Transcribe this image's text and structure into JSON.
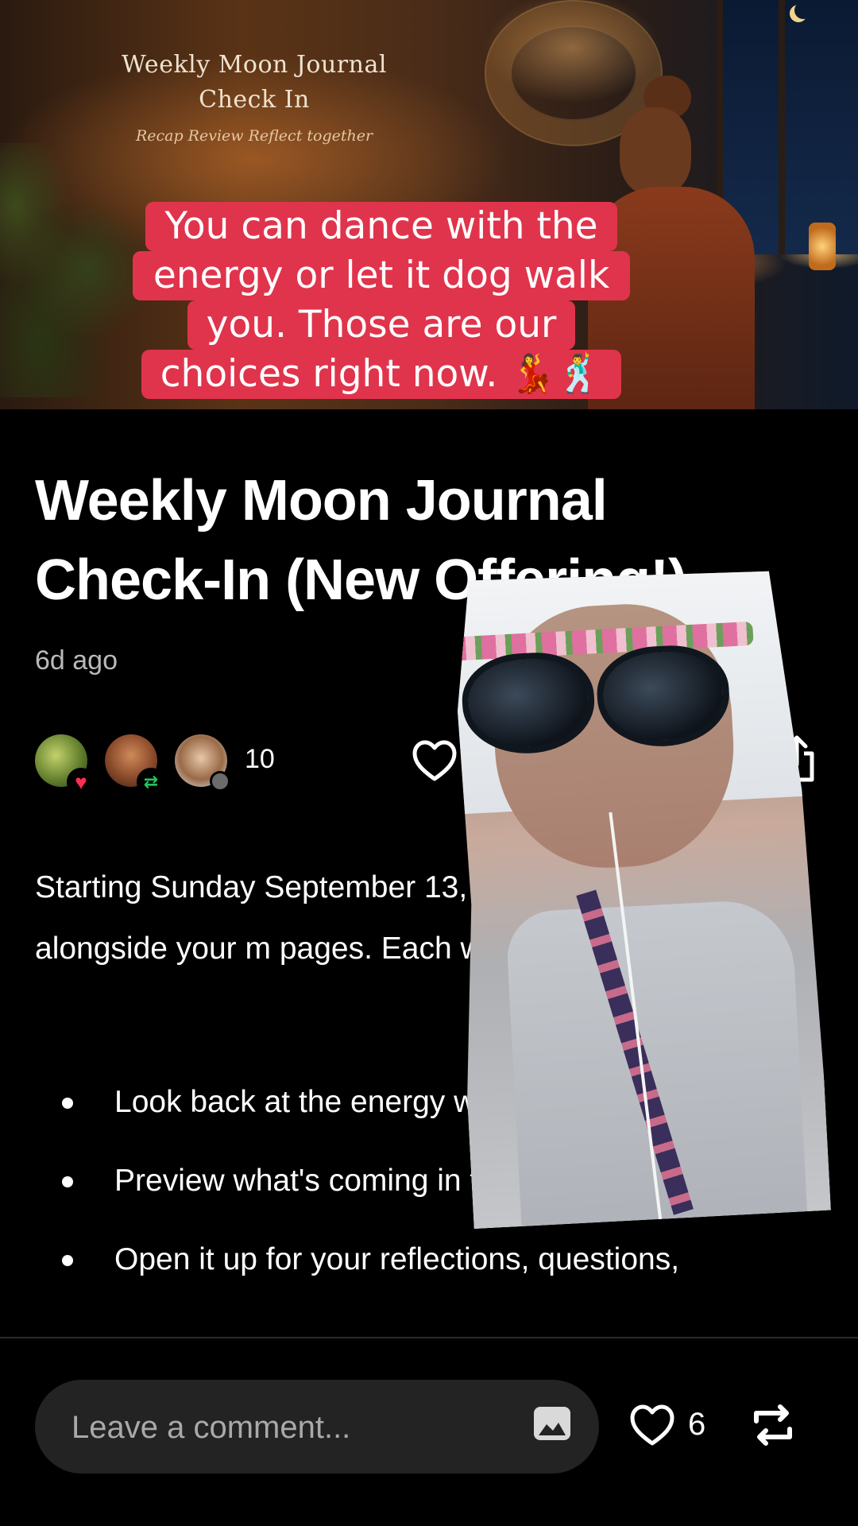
{
  "cover": {
    "title_line1": "Weekly Moon Journal",
    "title_line2": "Check In",
    "tagline": "Recap Review Reflect together"
  },
  "caption": {
    "line1": "You can dance with the",
    "line2": "energy or let it dog walk",
    "line3": "you. Those are our",
    "line4": "choices right now. 💃🕺"
  },
  "post": {
    "title": "Weekly Moon Journal Check-In (New Offering!)",
    "timestamp": "6d ago",
    "engagement_count": "10",
    "body": "Starting Sunday September 13, I'll be h live Zoom to go alongside your m pages. Each week, we'll gather",
    "bullets": [
      "Look back at the energy w through",
      "Preview what's coming in the week ahead",
      "Open it up for your reflections, questions,"
    ]
  },
  "comment_bar": {
    "placeholder": "Leave a comment...",
    "like_count": "6"
  },
  "icons": {
    "like": "heart-icon",
    "comment": "comment-icon",
    "share": "share-icon",
    "image": "image-icon",
    "repost": "repost-icon"
  },
  "colors": {
    "caption_bg": "#e0344c",
    "like_badge": "#ff2d55",
    "repost_badge": "#22c55e",
    "background": "#000000"
  }
}
